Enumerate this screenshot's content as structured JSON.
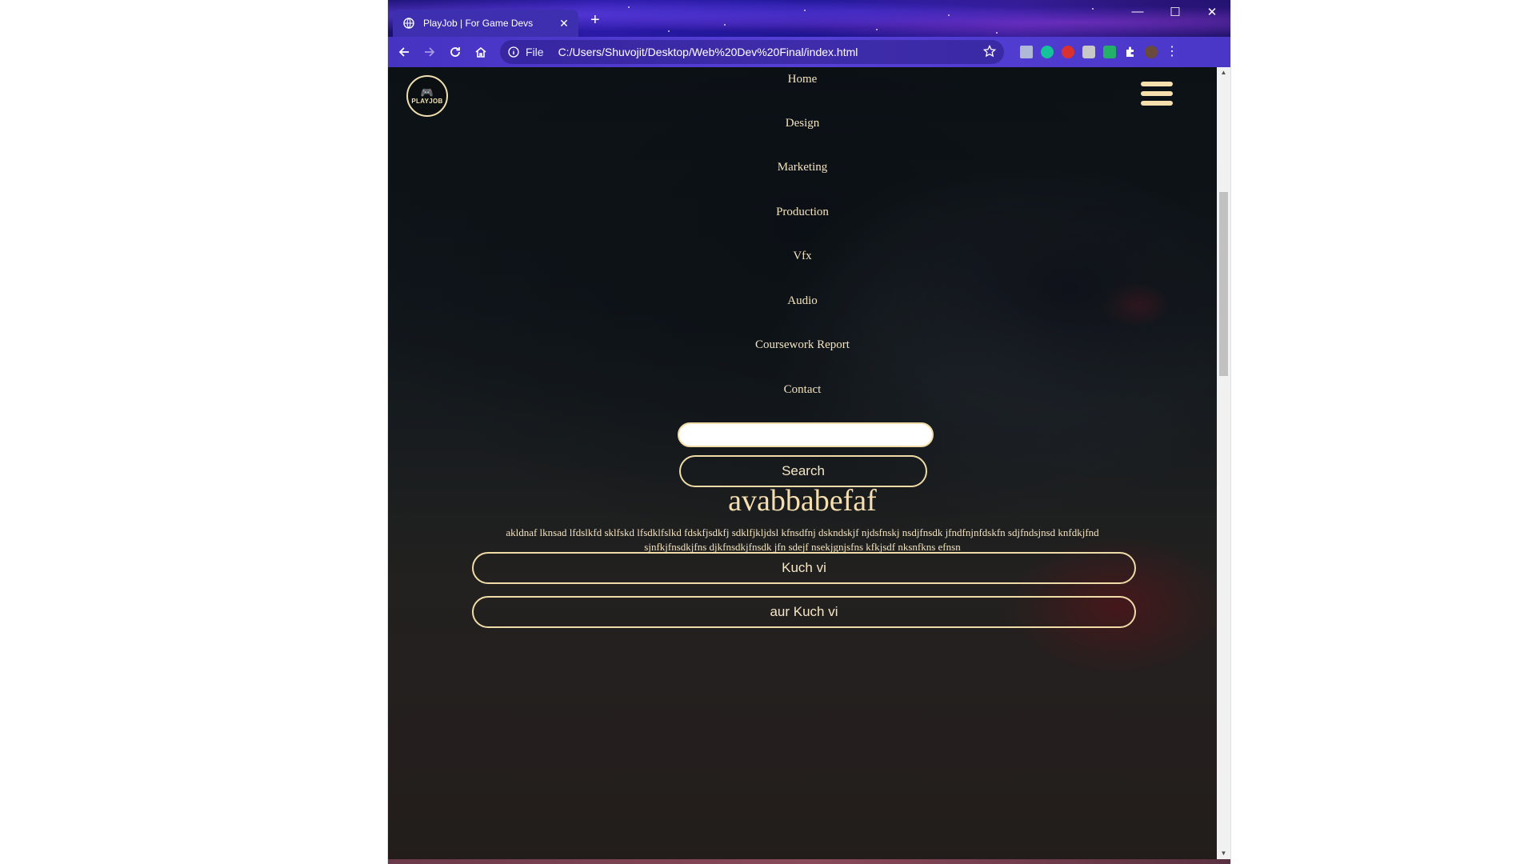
{
  "browser": {
    "tab_title": "PlayJob | For Game Devs",
    "tab_close": "✕",
    "new_tab": "+",
    "window_controls": {
      "minimize": "—",
      "maximize": "☐",
      "close": "✕"
    },
    "nav": {
      "back": "←",
      "forward": "→",
      "reload": "↻",
      "home": "⌂"
    },
    "omnibox": {
      "scheme_label": "File",
      "url": "C:/Users/Shuvojit/Desktop/Web%20Dev%20Final/index.html"
    },
    "extensions": [
      "pdf-extension-icon",
      "grammarly-icon",
      "adblock-icon",
      "extension-icon",
      "shield-extension-icon",
      "puzzle-icon",
      "profile-avatar"
    ],
    "menu_icon": "⋮"
  },
  "page": {
    "logo": {
      "glyph": "🎮",
      "text": "PLAYJOB"
    },
    "menu": [
      "Home",
      "Design",
      "Marketing",
      "Production",
      "Vfx",
      "Audio",
      "Coursework Report",
      "Contact"
    ],
    "search": {
      "input_value": "",
      "button_label": "Search"
    },
    "heading": "avabbabefaf",
    "paragraph": "akldnaf lknsad lfdslkfd sklfskd lfsdklfslkd fdskfjsdkfj sdklfjkljdsl kfnsdfnj dskndskjf njdsfnskj nsdjfnsdk jfndfnjnfdskfn sdjfndsjnsd knfdkjfnd sjnfkjfnsdkjfns djkfnsdkjfnsdk jfn sdejf nsekjgnjsfns kfkjsdf nksnfkns efnsn",
    "buttons": [
      "Kuch vi",
      "aur Kuch vi"
    ]
  },
  "colors": {
    "accent_cream": "#f0dca8",
    "toolbar": "#4b36c9",
    "text_cream": "#f3e3c0"
  }
}
